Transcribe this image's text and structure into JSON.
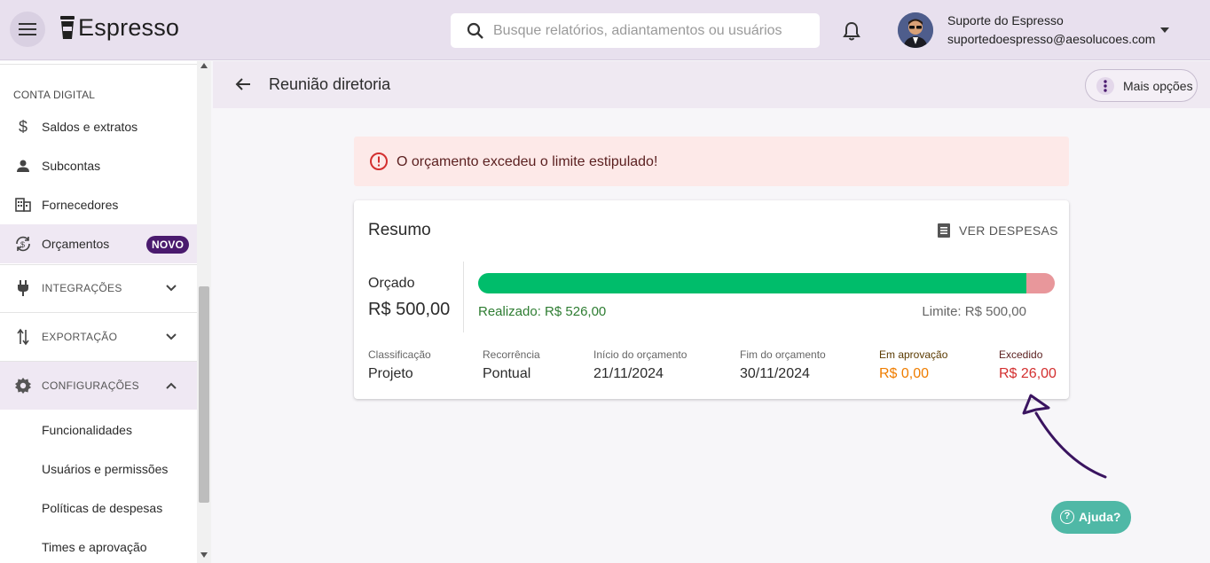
{
  "app": {
    "logo_text": "Espresso",
    "search_placeholder": "Busque relatórios, adiantamentos ou usuários",
    "user_name": "Suporte do Espresso",
    "user_email": "suportedoespresso@aesolucoes.com"
  },
  "sidebar": {
    "section_label": "CONTA DIGITAL",
    "items": [
      {
        "label": "Saldos e extratos",
        "icon": "dollar-icon"
      },
      {
        "label": "Subcontas",
        "icon": "person-icon"
      },
      {
        "label": "Fornecedores",
        "icon": "building-icon"
      },
      {
        "label": "Orçamentos",
        "icon": "budget-cycle-icon",
        "badge": "NOVO"
      },
      {
        "label": "INTEGRAÇÕES",
        "icon": "plug-icon"
      },
      {
        "label": "EXPORTAÇÃO",
        "icon": "swap-vertical-icon"
      },
      {
        "label": "CONFIGURAÇÕES",
        "icon": "gear-icon"
      }
    ],
    "sub_items": [
      "Funcionalidades",
      "Usuários e permissões",
      "Políticas de despesas",
      "Times e aprovação"
    ]
  },
  "page": {
    "title": "Reunião diretoria",
    "more_options_label": "Mais opções"
  },
  "alert": {
    "message": "O orçamento excedeu o limite estipulado!"
  },
  "summary": {
    "title": "Resumo",
    "view_expenses_label": "VER DESPESAS",
    "budget_label": "Orçado",
    "budget_value": "R$ 500,00",
    "realized_text": "Realizado: R$ 526,00",
    "limit_text": "Limite: R$ 500,00",
    "progress": {
      "realized": 526,
      "limit": 500
    },
    "details": [
      {
        "label": "Classificação",
        "value": "Projeto"
      },
      {
        "label": "Recorrência",
        "value": "Pontual"
      },
      {
        "label": "Início do orçamento",
        "value": "21/11/2024"
      },
      {
        "label": "Fim do orçamento",
        "value": "30/11/2024"
      },
      {
        "label": "Em aprovação",
        "value": "R$ 0,00"
      },
      {
        "label": "Excedido",
        "value": "R$ 26,00"
      }
    ]
  },
  "help": {
    "label": "Ajuda?"
  },
  "colors": {
    "accent": "#4a1a6e",
    "progress_ok": "#00bd6b",
    "progress_over": "#e8979b",
    "warning": "#ef7d00",
    "error": "#d32f2f"
  }
}
